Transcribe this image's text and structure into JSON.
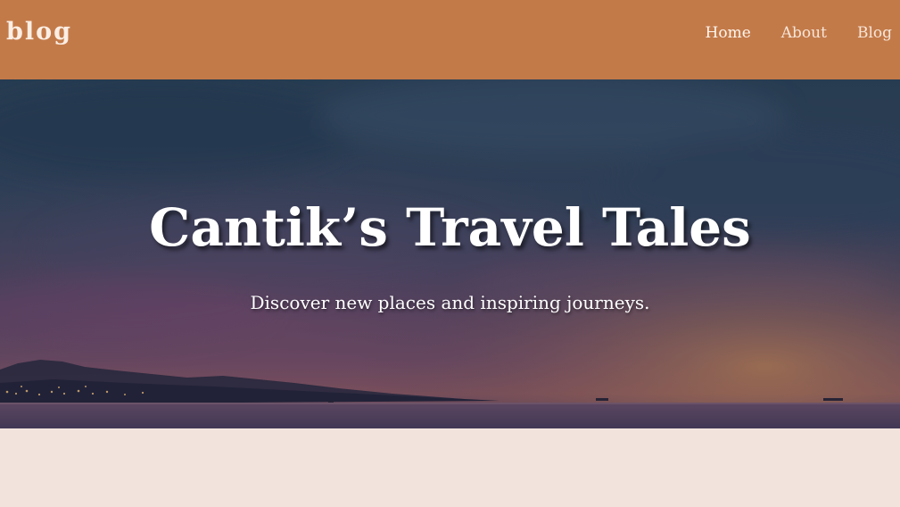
{
  "navbar": {
    "logo": "blog",
    "links": [
      "Home",
      "About",
      "Blog"
    ],
    "background": "#c37a49"
  },
  "hero": {
    "title": "Cantik’s Travel Tales",
    "subtitle": "Discover new places and inspiring journeys."
  },
  "page": {
    "background": "#f2e4dc"
  }
}
